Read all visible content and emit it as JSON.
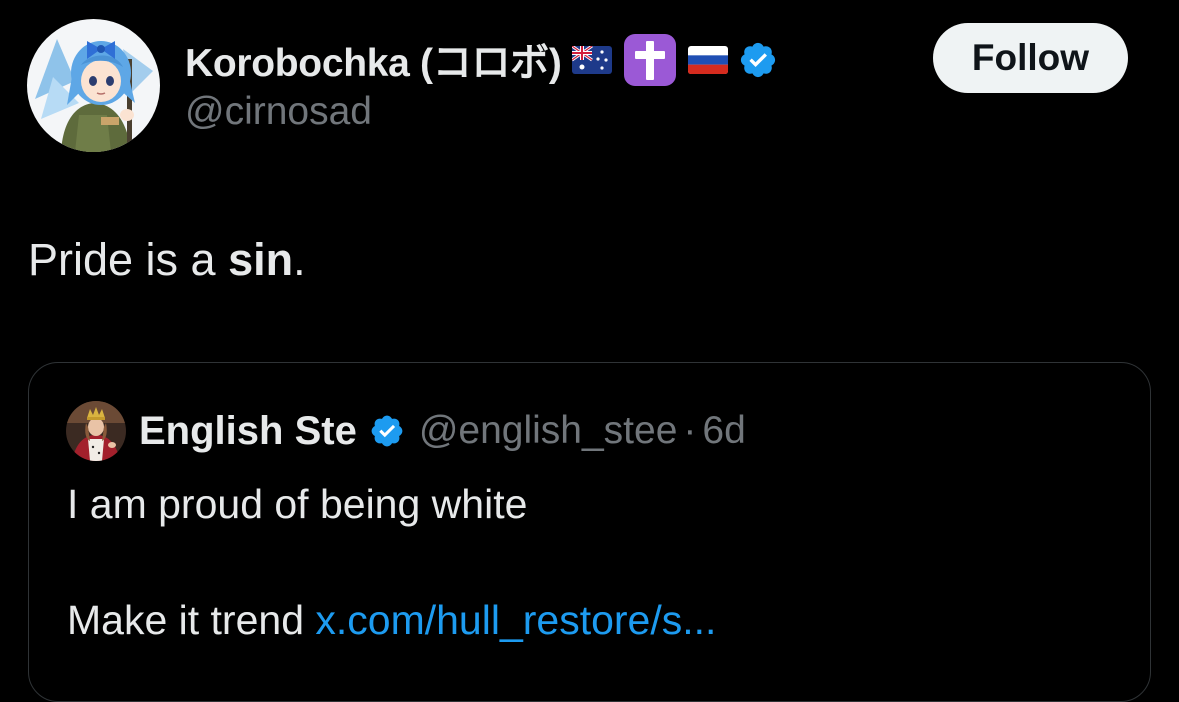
{
  "author": {
    "display_name": "Korobochka (コロボ)",
    "handle": "@cirnosad",
    "emojis": [
      "flag-australia",
      "latin-cross",
      "flag-russia"
    ],
    "verified": true,
    "avatar_icon": "anime-character-avatar"
  },
  "follow_button": {
    "label": "Follow"
  },
  "tweet": {
    "text_prefix": "Pride is a ",
    "text_bold": "sin",
    "text_suffix": "."
  },
  "quote": {
    "display_name": "English Ste",
    "handle": "@english_stee",
    "separator": "·",
    "time": "6d",
    "verified": true,
    "avatar_icon": "king-portrait-avatar",
    "line1": "I am proud of being white",
    "line2_prefix": "Make it trend ",
    "link_text": "x.com/hull_restore/s..."
  },
  "colors": {
    "background": "#000000",
    "text_primary": "#e7e9ea",
    "text_secondary": "#71767b",
    "link": "#1d9bf0",
    "verified": "#1d9bf0",
    "follow_bg": "#eff3f4",
    "border": "#2f3336"
  }
}
